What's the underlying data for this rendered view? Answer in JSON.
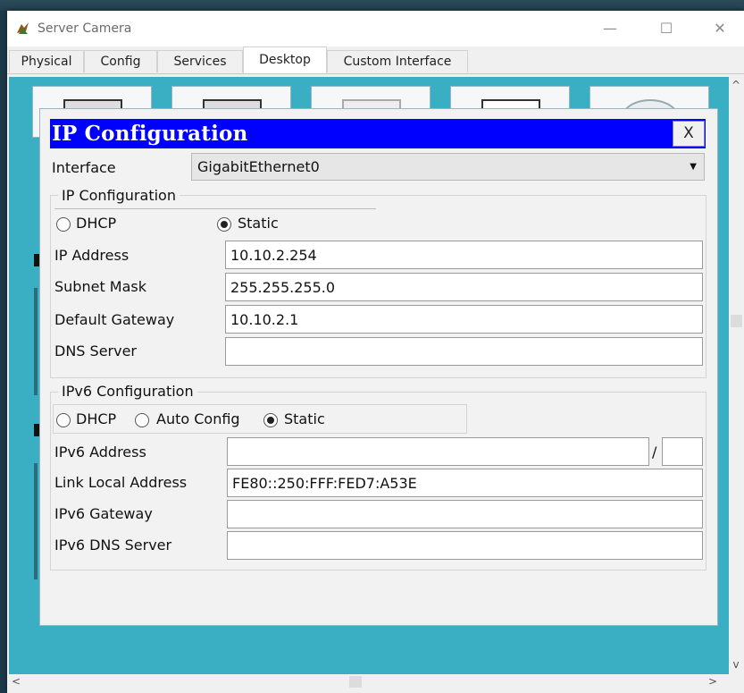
{
  "window": {
    "title": "Server Camera",
    "icon": "packet-tracer-icon",
    "minimize_glyph": "—",
    "maximize_glyph": "☐",
    "close_glyph": "✕"
  },
  "tabs": [
    {
      "label": "Physical"
    },
    {
      "label": "Config"
    },
    {
      "label": "Services"
    },
    {
      "label": "Desktop",
      "active": true
    },
    {
      "label": "Custom Interface"
    }
  ],
  "dialog": {
    "title": "IP Configuration",
    "close_label": "X",
    "interface_label": "Interface",
    "interface_value": "GigabitEthernet0",
    "ipv4": {
      "group_title": "IP Configuration",
      "dhcp_label": "DHCP",
      "static_label": "Static",
      "selected": "Static",
      "ip_address_label": "IP Address",
      "ip_address_value": "10.10.2.254",
      "subnet_mask_label": "Subnet Mask",
      "subnet_mask_value": "255.255.255.0",
      "gateway_label": "Default Gateway",
      "gateway_value": "10.10.2.1",
      "dns_label": "DNS Server",
      "dns_value": ""
    },
    "ipv6": {
      "group_title": "IPv6 Configuration",
      "dhcp_label": "DHCP",
      "auto_label": "Auto Config",
      "static_label": "Static",
      "selected": "Static",
      "address_label": "IPv6 Address",
      "address_value": "",
      "prefix_separator": "/",
      "prefix_value": "",
      "link_local_label": "Link Local Address",
      "link_local_value": "FE80::250:FFF:FED7:A53E",
      "gateway_label": "IPv6 Gateway",
      "gateway_value": "",
      "dns_label": "IPv6 DNS Server",
      "dns_value": ""
    }
  },
  "scrollbars": {
    "up": "^",
    "down": "v",
    "left": "<",
    "right": ">"
  },
  "colors": {
    "dialog_header": "#0000ff",
    "desktop_background": "#3aaec3"
  }
}
